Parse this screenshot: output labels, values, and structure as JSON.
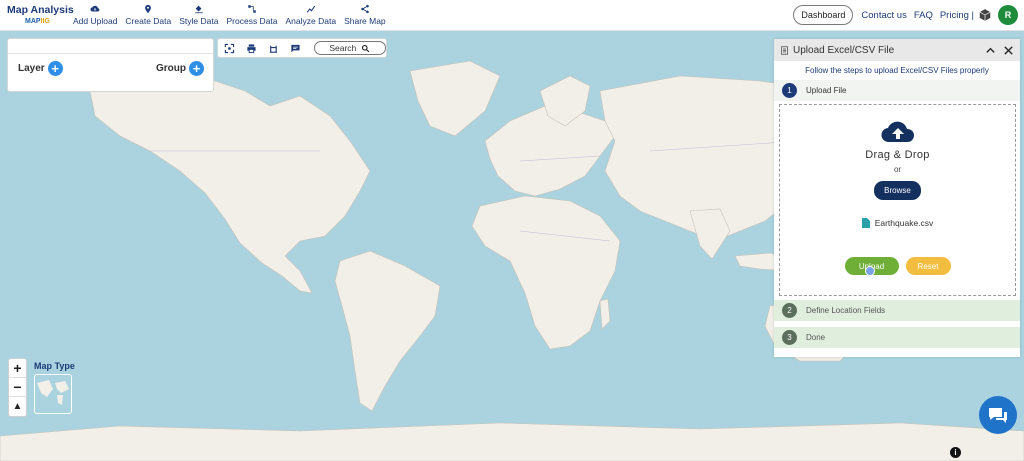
{
  "app": {
    "logo_title": "Map Analysis",
    "logo_sub_a": "MAP",
    "logo_sub_b": "IIG"
  },
  "menu": [
    {
      "label": "Add Upload",
      "icon": "cloud-upload-icon"
    },
    {
      "label": "Create Data",
      "icon": "map-pin-icon"
    },
    {
      "label": "Style Data",
      "icon": "paint-bucket-icon"
    },
    {
      "label": "Process Data",
      "icon": "process-icon"
    },
    {
      "label": "Analyze Data",
      "icon": "analyze-icon"
    },
    {
      "label": "Share Map",
      "icon": "share-icon"
    }
  ],
  "nav": {
    "dashboard": "Dashboard",
    "contact": "Contact us",
    "faq": "FAQ",
    "pricing": "Pricing |",
    "avatar": "R"
  },
  "layer_panel": {
    "layer_label": "Layer",
    "group_label": "Group"
  },
  "toolbar": {
    "search_label": "Search"
  },
  "map_controls": {
    "zoom_in": "+",
    "zoom_out": "−",
    "north": "▲",
    "map_type_label": "Map Type"
  },
  "upload_panel": {
    "title": "Upload Excel/CSV File",
    "subtitle": "Follow the steps to upload Excel/CSV Files properly",
    "steps": [
      {
        "num": "1",
        "label": "Upload File"
      },
      {
        "num": "2",
        "label": "Define Location Fields"
      },
      {
        "num": "3",
        "label": "Done"
      }
    ],
    "drag_drop": "Drag & Drop",
    "or": "or",
    "browse": "Browse",
    "file_name": "Earthquake.csv",
    "upload_btn": "Upload",
    "reset_btn": "Reset"
  },
  "info": "i",
  "colors": {
    "ocean": "#aad3df",
    "land": "#f2efe9",
    "navy": "#1d3b78",
    "upload_green": "#6faf37",
    "reset_yellow": "#f3bd3f",
    "avatar_green": "#1e8c3a"
  }
}
